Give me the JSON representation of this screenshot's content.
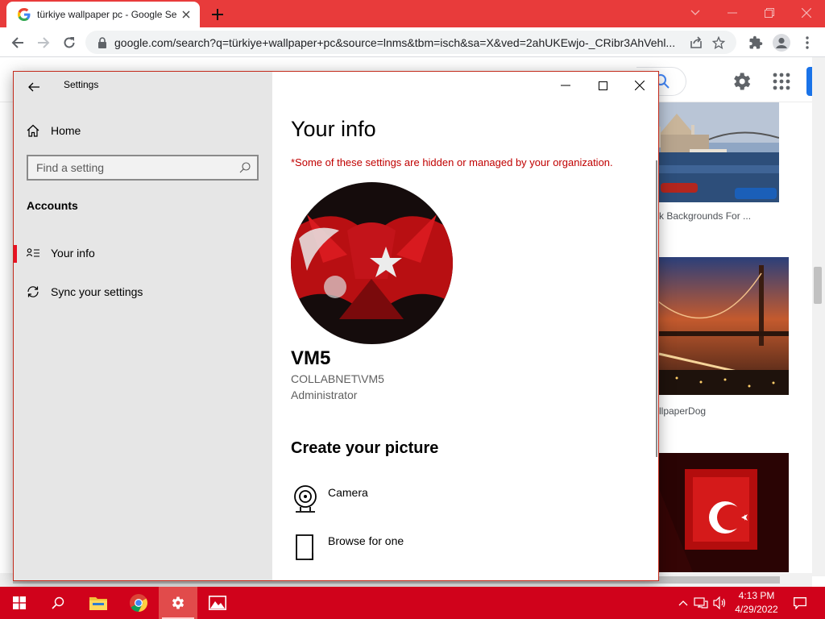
{
  "colors": {
    "chrome_frame": "#e83b3b",
    "taskbar": "#d0021b",
    "settings_nav_bg": "#e6e6e6",
    "selection_accent": "#e81123",
    "warning_text": "#c00000"
  },
  "browser": {
    "tab_title": "türkiye wallpaper pc - Google Se",
    "url": "google.com/search?q=türkiye+wallpaper+pc&source=lnms&tbm=isch&sa=X&ved=2ahUKEwjo-_CRibr3AhVehl...",
    "icons": [
      "google-favicon",
      "close-icon",
      "plus-icon",
      "chevron-down-icon",
      "minimize-icon",
      "restore-icon",
      "close-icon",
      "back-arrow-icon",
      "forward-arrow-icon",
      "reload-icon",
      "lock-icon",
      "share-icon",
      "star-icon",
      "puzzle-icon",
      "profile-icon",
      "kebab-menu-icon"
    ]
  },
  "google": {
    "captions": {
      "thumb1": "k Backgrounds For ...",
      "thumb2": "llpaperDog"
    }
  },
  "settings": {
    "window_title": "Settings",
    "nav": {
      "home": "Home",
      "search_placeholder": "Find a setting",
      "section": "Accounts",
      "items": [
        {
          "label": "Your info",
          "icon": "person-card-icon",
          "selected": true
        },
        {
          "label": "Sync your settings",
          "icon": "sync-icon",
          "selected": false
        }
      ]
    },
    "content": {
      "heading": "Your info",
      "org_note": "*Some of these settings are hidden or managed by your organization.",
      "user": {
        "name": "VM5",
        "account": "COLLABNET\\VM5",
        "role": "Administrator"
      },
      "create_heading": "Create your picture",
      "options": [
        {
          "label": "Camera",
          "icon": "webcam-icon"
        },
        {
          "label": "Browse for one",
          "icon": "document-icon"
        }
      ]
    }
  },
  "taskbar": {
    "apps": [
      "windows-start-icon",
      "search-icon",
      "file-explorer-icon",
      "chrome-icon",
      "settings-gear-icon",
      "photos-icon"
    ],
    "time": "4:13 PM",
    "date": "4/29/2022"
  }
}
